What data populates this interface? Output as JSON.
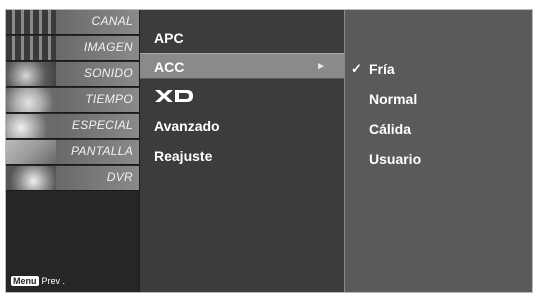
{
  "sidebar": {
    "categories": [
      {
        "label": "CANAL"
      },
      {
        "label": "IMAGEN"
      },
      {
        "label": "SONIDO"
      },
      {
        "label": "TIEMPO"
      },
      {
        "label": "ESPECIAL"
      },
      {
        "label": "PANTALLA"
      },
      {
        "label": "DVR"
      }
    ],
    "menu_key": "Menu",
    "prev_label": "Prev ."
  },
  "submenu": {
    "items": [
      {
        "label": "APC"
      },
      {
        "label": "ACC",
        "selected": true
      },
      {
        "label": "XD",
        "icon": "xd-logo-icon"
      },
      {
        "label": "Avanzado"
      },
      {
        "label": "Reajuste"
      }
    ],
    "arrow": "►"
  },
  "options": {
    "check_mark": "✓",
    "items": [
      {
        "label": "Fría",
        "checked": true
      },
      {
        "label": "Normal"
      },
      {
        "label": "Cálida"
      },
      {
        "label": "Usuario"
      }
    ]
  },
  "colors": {
    "background": "#303030",
    "selected_item": "#8a8a8a",
    "options_panel": "#5a5a5a",
    "text": "#ffffff"
  }
}
